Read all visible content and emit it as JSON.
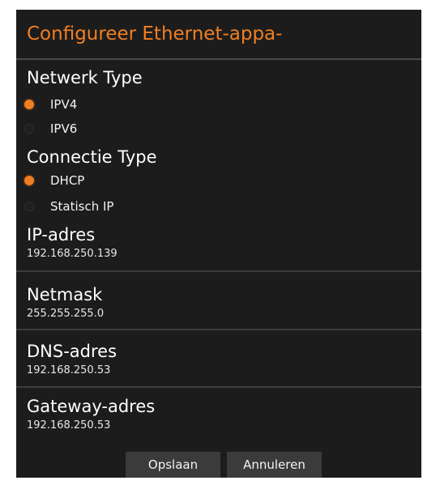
{
  "dialog": {
    "title": "Configureer Ethernet-appa-"
  },
  "network_type": {
    "label": "Netwerk Type",
    "options": [
      {
        "label": "IPV4",
        "selected": true
      },
      {
        "label": "IPV6",
        "selected": false
      }
    ]
  },
  "connection_type": {
    "label": "Connectie Type",
    "options": [
      {
        "label": "DHCP",
        "selected": true
      },
      {
        "label": "Statisch IP",
        "selected": false
      }
    ]
  },
  "fields": {
    "ip": {
      "label": "IP-adres",
      "value": "192.168.250.139"
    },
    "netmask": {
      "label": "Netmask",
      "value": "255.255.255.0"
    },
    "dns": {
      "label": "DNS-adres",
      "value": "192.168.250.53"
    },
    "gateway": {
      "label": "Gateway-adres",
      "value": "192.168.250.53"
    }
  },
  "buttons": {
    "save": "Opslaan",
    "cancel": "Annuleren"
  },
  "colors": {
    "accent": "#f07f22",
    "background": "#1c1c1c",
    "button": "#3b3b3b"
  }
}
